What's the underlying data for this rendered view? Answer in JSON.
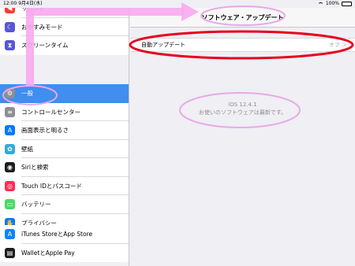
{
  "status": {
    "time": "12:00",
    "date": "9月4日(水)",
    "battery": "100%"
  },
  "sidebar": {
    "top_items": [
      {
        "label": "サウンド",
        "icon": "speaker-icon",
        "color": "#ff3b30",
        "glyph": "◀"
      },
      {
        "label": "おやすみモード",
        "icon": "moon-icon",
        "color": "#5856d6",
        "glyph": "☾"
      },
      {
        "label": "スクリーンタイム",
        "icon": "hourglass-icon",
        "color": "#5856d6",
        "glyph": "⧗"
      }
    ],
    "middle_items": [
      {
        "label": "一般",
        "icon": "gear-icon",
        "color": "#8e8e93",
        "glyph": "⚙",
        "selected": true
      },
      {
        "label": "コントロールセンター",
        "icon": "switches-icon",
        "color": "#8e8e93",
        "glyph": "≡"
      },
      {
        "label": "画面表示と明るさ",
        "icon": "display-icon",
        "color": "#007aff",
        "glyph": "A"
      },
      {
        "label": "壁紙",
        "icon": "wallpaper-icon",
        "color": "#34aadc",
        "glyph": "✿"
      },
      {
        "label": "Siriと検索",
        "icon": "siri-icon",
        "color": "#1c1c1e",
        "glyph": "◉"
      },
      {
        "label": "Touch IDとパスコード",
        "icon": "fingerprint-icon",
        "color": "#ff2d55",
        "glyph": "◎"
      },
      {
        "label": "バッテリー",
        "icon": "battery-icon",
        "color": "#4cd964",
        "glyph": "▭"
      },
      {
        "label": "プライバシー",
        "icon": "hand-icon",
        "color": "#007aff",
        "glyph": "✋"
      }
    ],
    "bottom_items": [
      {
        "label": "iTunes StoreとApp Store",
        "icon": "app-store-icon",
        "color": "#0a84ff",
        "glyph": "A"
      },
      {
        "label": "WalletとApple Pay",
        "icon": "wallet-icon",
        "color": "#1c1c1e",
        "glyph": "▤"
      }
    ]
  },
  "detail": {
    "title": "ソフトウェア・アップデート",
    "auto_update_label": "自動アップデート",
    "auto_update_value": "オフ ＞",
    "version": "iOS 12.4.1",
    "status_message": "お使いのソフトウェアは最新です。"
  },
  "annotations": {
    "arrow_color": "#f7a8f0",
    "highlight_color": "#e8a9e8",
    "red_color": "#e8001c"
  }
}
